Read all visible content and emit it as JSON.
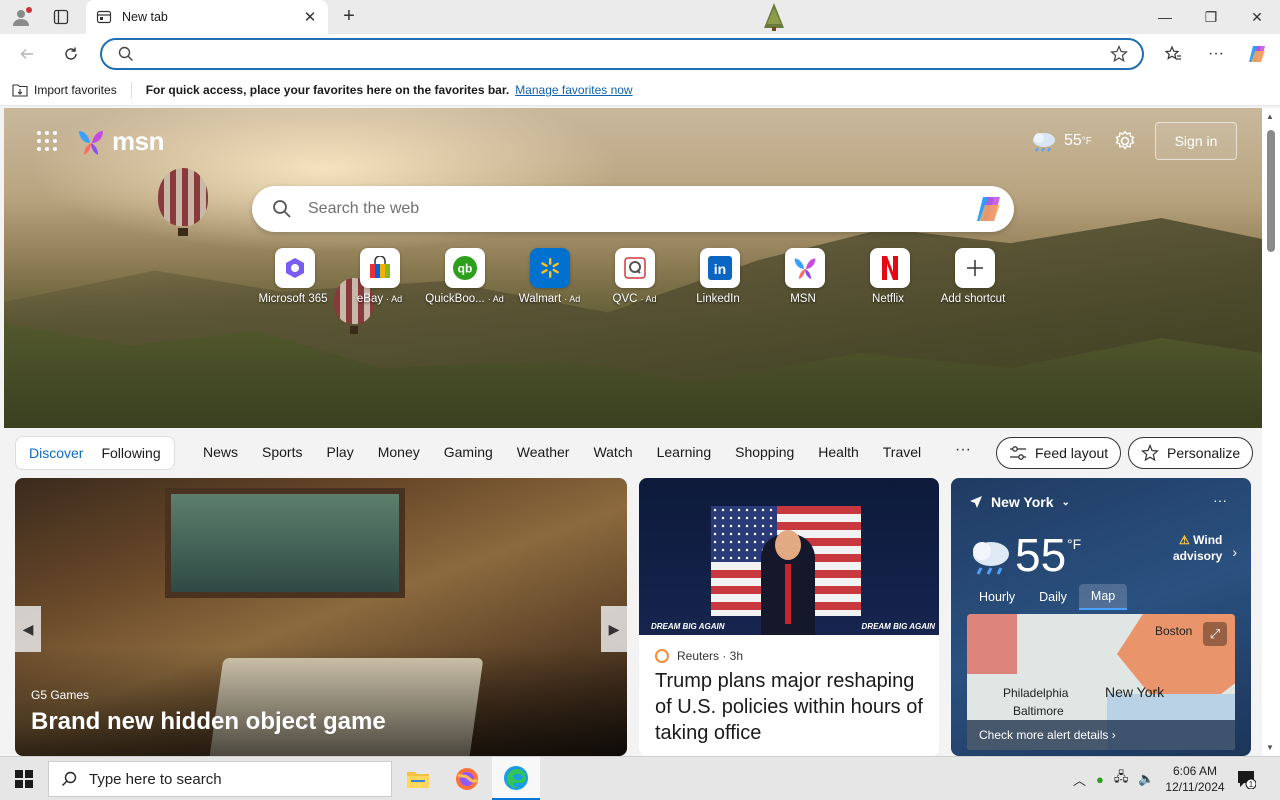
{
  "browser": {
    "tab_title": "New tab",
    "address_value": "",
    "address_placeholder": ""
  },
  "favorites_bar": {
    "import_label": "Import favorites",
    "message": "For quick access, place your favorites here on the favorites bar.",
    "manage_link": "Manage favorites now"
  },
  "msn": {
    "logo_text": "msn",
    "weather_temp": "55",
    "weather_unit": "°F",
    "signin_label": "Sign in",
    "search_placeholder": "Search the web"
  },
  "shortcuts": [
    {
      "label": "Microsoft 365",
      "ad": "",
      "icon": "microsoft-365-icon",
      "color": "#7b5cf0"
    },
    {
      "label": "eBay",
      "ad": "· Ad",
      "icon": "ebay-icon",
      "color": "#e53238"
    },
    {
      "label": "QuickBoo...",
      "ad": "· Ad",
      "icon": "quickbooks-icon",
      "color": "#2ca01c"
    },
    {
      "label": "Walmart",
      "ad": "· Ad",
      "icon": "walmart-icon",
      "color": "#0071ce"
    },
    {
      "label": "QVC",
      "ad": "· Ad",
      "icon": "qvc-icon",
      "color": "#d0383a"
    },
    {
      "label": "LinkedIn",
      "ad": "",
      "icon": "linkedin-icon",
      "color": "#0a66c2"
    },
    {
      "label": "MSN",
      "ad": "",
      "icon": "msn-icon",
      "color": "#8a4ef0"
    },
    {
      "label": "Netflix",
      "ad": "",
      "icon": "netflix-icon",
      "color": "#e50914"
    },
    {
      "label": "Add shortcut",
      "ad": "",
      "icon": "plus-icon",
      "color": "#333333"
    }
  ],
  "feed_nav": {
    "discover": "Discover",
    "following": "Following",
    "items": [
      "News",
      "Sports",
      "Play",
      "Money",
      "Gaming",
      "Weather",
      "Watch",
      "Learning",
      "Shopping",
      "Health",
      "Travel"
    ],
    "more": "···",
    "feed_layout": "Feed layout",
    "personalize": "Personalize"
  },
  "card_big": {
    "source": "G5 Games",
    "title": "Brand new hidden object game"
  },
  "card_news": {
    "source": "Reuters · 3h",
    "headline": "Trump plans major reshaping of U.S. policies within hours of taking office",
    "banner_left": "DREAM BIG AGAIN",
    "banner_right": "DREAM BIG AGAIN"
  },
  "card_weather": {
    "location": "New York",
    "temp": "55",
    "unit": "°F",
    "alert_line1": "Wind",
    "alert_line2": "advisory",
    "tabs": [
      "Hourly",
      "Daily",
      "Map"
    ],
    "active_tab": "Map",
    "map_cities": [
      "Boston",
      "Philadelphia",
      "New York",
      "Baltimore"
    ],
    "footer": "Check more alert details"
  },
  "taskbar": {
    "search_placeholder": "Type here to search",
    "time": "6:06 AM",
    "date": "12/11/2024",
    "notification_count": "1"
  }
}
